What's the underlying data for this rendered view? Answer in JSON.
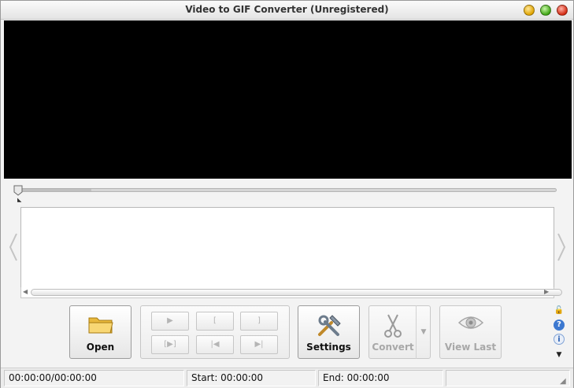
{
  "window": {
    "title": "Video to GIF Converter (Unregistered)",
    "minimize_label": "minimize",
    "maximize_label": "maximize",
    "close_label": "close"
  },
  "player": {
    "seek_position": 0.0
  },
  "playback": {
    "play_glyph": "▶",
    "mark_start_glyph": "[",
    "mark_end_glyph": "]",
    "play_selection_glyph": "[▶]",
    "go_start_glyph": "|◀",
    "go_end_glyph": "▶|"
  },
  "toolbar": {
    "open_label": "Open",
    "settings_label": "Settings",
    "convert_label": "Convert",
    "view_last_label": "View Last",
    "convert_menu_glyph": "▼"
  },
  "side_icons": {
    "lock_glyph": "🔓",
    "help_glyph": "?",
    "info_glyph": "i",
    "more_glyph": "▼"
  },
  "status": {
    "position_text": "00:00:00/00:00:00",
    "start_text": "Start: 00:00:00",
    "end_text": "End: 00:00:00",
    "extra_text": ""
  },
  "colors": {
    "video_bg": "#000000",
    "window_bg": "#f3f3f3",
    "disabled_text": "#a8a8a8"
  }
}
